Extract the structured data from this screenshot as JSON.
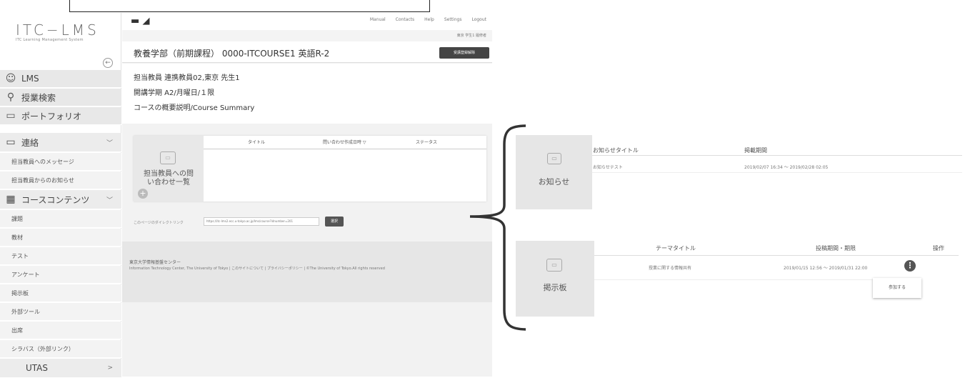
{
  "sidebar": {
    "logo": "ITC−LMS",
    "logo_sub": "ITC Learning Management System",
    "collapse_icon": "←",
    "main_items": [
      {
        "label": "LMS",
        "icon": "☺"
      },
      {
        "label": "授業検索",
        "icon": "⚲"
      },
      {
        "label": "ポートフォリオ",
        "icon": "▭"
      }
    ],
    "groups": [
      {
        "label": "連絡",
        "icon": "▭",
        "sub": [
          "担当教員へのメッセージ",
          "担当教員からのお知らせ"
        ]
      },
      {
        "label": "コースコンテンツ",
        "icon": "▦",
        "sub": [
          "課題",
          "教材",
          "テスト",
          "アンケート",
          "掲示板",
          "外部ツール",
          "出席",
          "シラバス（外部リンク）"
        ]
      }
    ],
    "utas": {
      "label": "UTAS",
      "chevron": ">"
    }
  },
  "topbar": {
    "nav": [
      "Manual",
      "Contacts",
      "Help",
      "Settings",
      "Logout"
    ],
    "user": "東京  学生1  履修者"
  },
  "course": {
    "title": "教養学部（前期課程） 0000-ITCOURSE1 英語R-2",
    "unregister_label": "受講登録解除",
    "teacher": "担当教員 連携教員02,東京  先生1",
    "schedule": "開講学期 A2/月曜日/１限",
    "summary": "コースの概要説明/Course Summary"
  },
  "inquiry": {
    "label": "担当教員への問い合わせ一覧",
    "icon": "▭",
    "plus": "+",
    "columns": [
      "タイトル",
      "問い合わせ作成日時 ▽",
      "ステータス"
    ]
  },
  "direct_link": {
    "label": "このページのダイレクトリンク",
    "url": "https://itc-lms2.ecc.u-tokyo.ac.jp/lms/course?idnumber=201",
    "button": "選択"
  },
  "footer": {
    "org": "東京大学情報基盤センター",
    "line": "Information Technology Center, The University of Tokyo  |  このサイトについて  |  プライバシーポリシー  |  ©The University of Tokyo.All rights reserved"
  },
  "notice": {
    "label": "お知らせ",
    "icon": "▭",
    "col_title": "お知らせタイトル",
    "col_period": "掲載期間",
    "row_title": "お知らせテスト",
    "row_period": "2019/02/07 16:34 ～ 2019/02/28 02:05"
  },
  "board": {
    "label": "掲示板",
    "icon": "▭",
    "col_theme": "テーマタイトル",
    "col_period": "投稿期間・期限",
    "col_op": "操作",
    "row_theme": "授業に関する情報共有",
    "row_period": "2019/01/15 12:56 ～ 2019/01/31 22:00",
    "op_icon": "⋮",
    "join_label": "参加する"
  }
}
